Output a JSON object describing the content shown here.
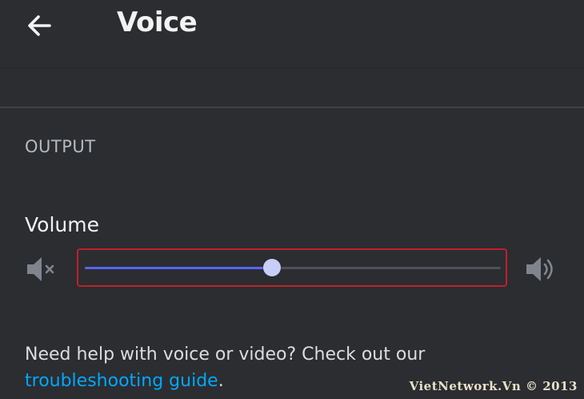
{
  "header": {
    "back_icon": "arrow-left-icon",
    "title": "Voice"
  },
  "output": {
    "section_label": "OUTPUT",
    "volume_label": "Volume",
    "mute_icon": "speaker-muted-icon",
    "loud_icon": "speaker-loud-icon",
    "volume_fraction": 0.45
  },
  "help": {
    "text_before": "Need help with voice or video? Check out our ",
    "link_text": "troubleshooting guide",
    "text_after": "."
  },
  "watermark": "VietNetwork.Vn © 2013",
  "colors": {
    "background": "#2b2d31",
    "accent": "#5865f2",
    "thumb": "#c9cdfb",
    "link": "#00a8fc",
    "highlight_border": "#c41e2a"
  }
}
